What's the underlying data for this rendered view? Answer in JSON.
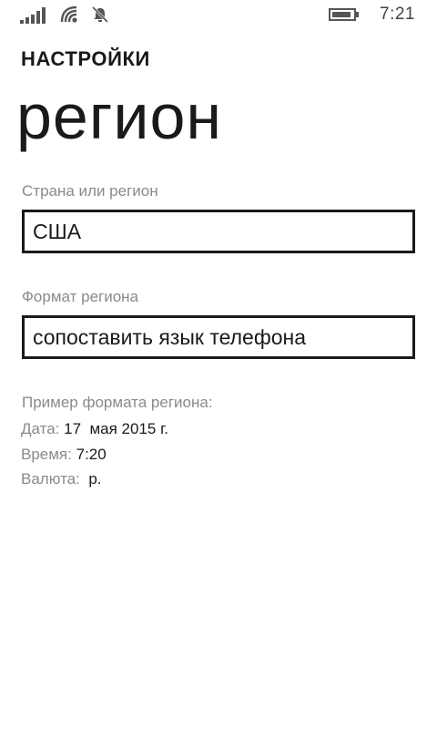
{
  "status_bar": {
    "icons": [
      "signal-icon",
      "wifi-icon",
      "quiet-hours-icon",
      "battery-icon"
    ],
    "time": "7:21"
  },
  "header": {
    "app_title": "НАСТРОЙКИ",
    "page_title": "регион"
  },
  "country": {
    "label": "Страна или регион",
    "value": "США"
  },
  "region_format": {
    "label": "Формат региона",
    "value": "сопоставить язык телефона"
  },
  "example": {
    "heading": "Пример формата региона:",
    "date_label": "Дата:",
    "date_value": "17  мая 2015 г.",
    "time_label": "Время:",
    "time_value": "7:20",
    "currency_label": "Валюта:",
    "currency_value": "р."
  },
  "colors": {
    "text": "#1a1a1a",
    "secondary_text": "#8a8a8a",
    "background": "#ffffff",
    "border": "#1a1a1a"
  }
}
